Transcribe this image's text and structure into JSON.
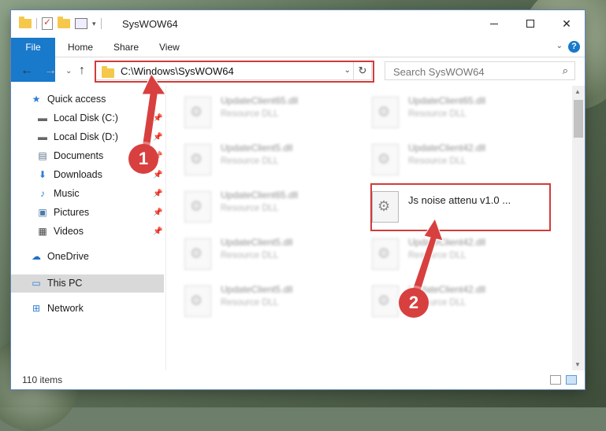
{
  "window": {
    "title": "SysWOW64"
  },
  "ribbon": {
    "tabs": [
      {
        "label": "File"
      },
      {
        "label": "Home"
      },
      {
        "label": "Share"
      },
      {
        "label": "View"
      }
    ]
  },
  "nav": {
    "address": "C:\\Windows\\SysWOW64",
    "search_placeholder": "Search SysWOW64"
  },
  "sidebar": {
    "items": [
      {
        "label": "Quick access",
        "icon": "star-icon",
        "pinned": false
      },
      {
        "label": "Local Disk (C:)",
        "icon": "drive-icon",
        "pinned": true
      },
      {
        "label": "Local Disk (D:)",
        "icon": "drive-icon",
        "pinned": true
      },
      {
        "label": "Documents",
        "icon": "documents-icon",
        "pinned": true
      },
      {
        "label": "Downloads",
        "icon": "download-icon",
        "pinned": true
      },
      {
        "label": "Music",
        "icon": "music-icon",
        "pinned": true
      },
      {
        "label": "Pictures",
        "icon": "pictures-icon",
        "pinned": true
      },
      {
        "label": "Videos",
        "icon": "videos-icon",
        "pinned": true
      },
      {
        "label": "OneDrive",
        "icon": "cloud-icon",
        "pinned": false
      },
      {
        "label": "This PC",
        "icon": "computer-icon",
        "pinned": false
      },
      {
        "label": "Network",
        "icon": "network-icon",
        "pinned": false
      }
    ],
    "selected": "This PC"
  },
  "files": [
    {
      "name": "UpdateClient65.dll",
      "type": "Resource DLL",
      "blurred": true
    },
    {
      "name": "UpdateClient65.dll",
      "type": "Resource DLL",
      "blurred": true
    },
    {
      "name": "UpdateClient5.dll",
      "type": "Resource DLL",
      "blurred": true
    },
    {
      "name": "UpdateClient42.dll",
      "type": "Resource DLL",
      "blurred": true
    },
    {
      "name": "UpdateClient65.dll",
      "type": "Resource DLL",
      "blurred": true
    },
    {
      "name": "Js noise attenu v1.0 ...",
      "type": "",
      "blurred": false
    },
    {
      "name": "UpdateClient5.dll",
      "type": "Resource DLL",
      "blurred": true
    },
    {
      "name": "UpdateClient42.dll",
      "type": "Resource DLL",
      "blurred": true
    },
    {
      "name": "UpdateClient5.dll",
      "type": "Resource DLL",
      "blurred": true
    },
    {
      "name": "UpdateClient42.dll",
      "type": "Resource DLL",
      "blurred": true
    }
  ],
  "status": {
    "item_count": "110 items"
  },
  "annotations": {
    "step1": "1",
    "step2": "2",
    "highlight_color": "#d23b3b"
  }
}
